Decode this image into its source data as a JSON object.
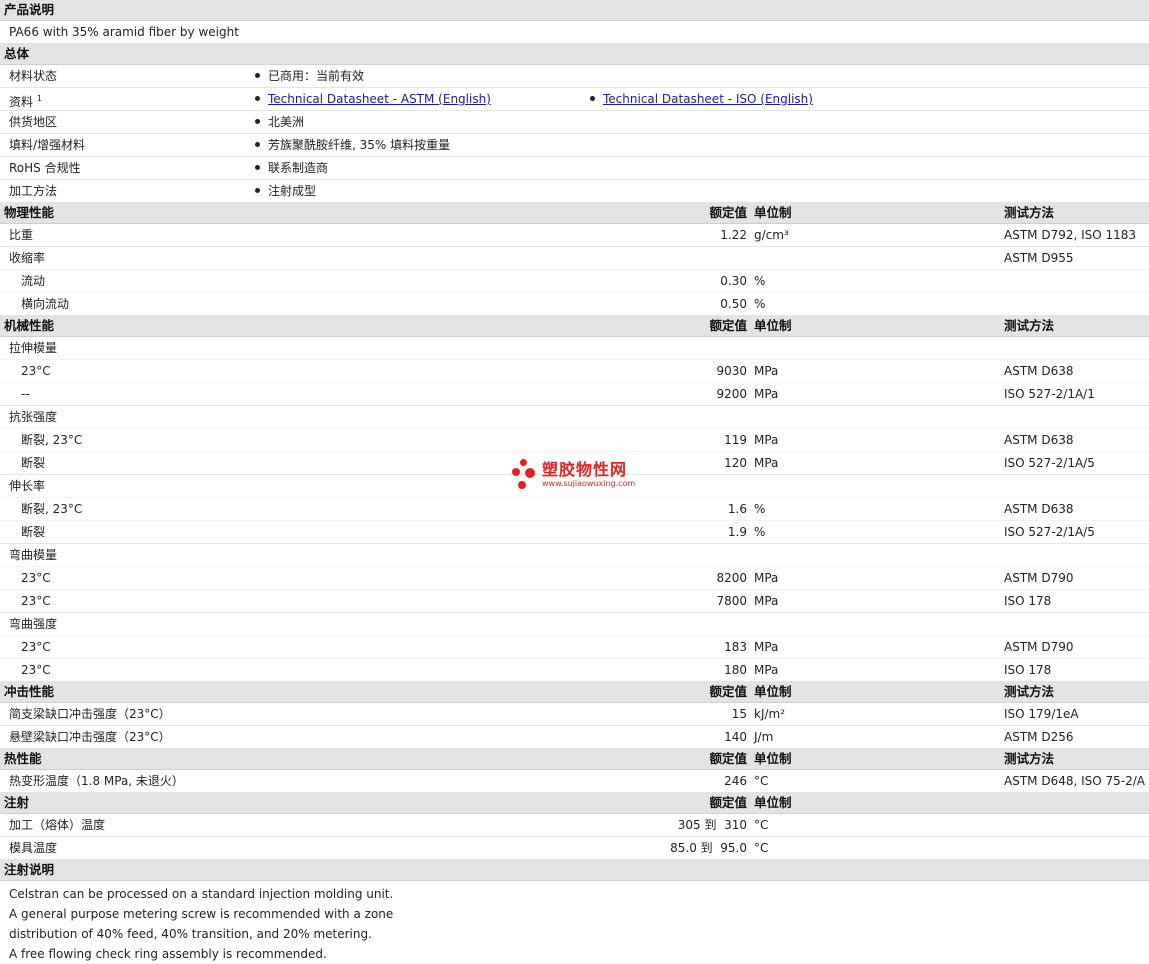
{
  "desc_section": {
    "title": "产品说明",
    "text": "PA66 with 35% aramid fiber by weight"
  },
  "general": {
    "title": "总体",
    "status_label": "材料状态",
    "status_value": "已商用：当前有效",
    "docs_label": "资料",
    "docs_sup": "1",
    "doc_astm": "Technical Datasheet - ASTM (English)",
    "doc_iso": "Technical Datasheet - ISO (English)",
    "region_label": "供货地区",
    "region_value": "北美洲",
    "filler_label": "填料/增强材料",
    "filler_value": "芳族聚酰胺纤维, 35% 填料按重量",
    "rohs_label": "RoHS 合规性",
    "rohs_value": "联系制造商",
    "process_label": "加工方法",
    "process_value": "注射成型"
  },
  "headers": {
    "value": "额定值",
    "unit": "单位制",
    "method": "测试方法"
  },
  "physical": {
    "title": "物理性能",
    "sg_label": "比重",
    "sg_value": "1.22",
    "sg_unit": "g/cm³",
    "sg_method": "ASTM D792, ISO 1183",
    "shrink_label": "收缩率",
    "shrink_method": "ASTM D955",
    "flow_label": "流动",
    "flow_value": "0.30",
    "flow_unit": "%",
    "tflow_label": "横向流动",
    "tflow_value": "0.50",
    "tflow_unit": "%"
  },
  "mechanical": {
    "title": "机械性能",
    "tm_label": "拉伸模量",
    "tm1_label": "23°C",
    "tm1_value": "9030",
    "tm1_unit": "MPa",
    "tm1_method": "ASTM D638",
    "tm2_label": "--",
    "tm2_value": "9200",
    "tm2_unit": "MPa",
    "tm2_method": "ISO 527-2/1A/1",
    "ts_label": "抗张强度",
    "ts1_label": "断裂, 23°C",
    "ts1_value": "119",
    "ts1_unit": "MPa",
    "ts1_method": "ASTM D638",
    "ts2_label": "断裂",
    "ts2_value": "120",
    "ts2_unit": "MPa",
    "ts2_method": "ISO 527-2/1A/5",
    "el_label": "伸长率",
    "el1_label": "断裂, 23°C",
    "el1_value": "1.6",
    "el1_unit": "%",
    "el1_method": "ASTM D638",
    "el2_label": "断裂",
    "el2_value": "1.9",
    "el2_unit": "%",
    "el2_method": "ISO 527-2/1A/5",
    "fm_label": "弯曲模量",
    "fm1_label": "23°C",
    "fm1_value": "8200",
    "fm1_unit": "MPa",
    "fm1_method": "ASTM D790",
    "fm2_label": "23°C",
    "fm2_value": "7800",
    "fm2_unit": "MPa",
    "fm2_method": "ISO 178",
    "fs_label": "弯曲强度",
    "fs1_label": "23°C",
    "fs1_value": "183",
    "fs1_unit": "MPa",
    "fs1_method": "ASTM D790",
    "fs2_label": "23°C",
    "fs2_value": "180",
    "fs2_unit": "MPa",
    "fs2_method": "ISO 178"
  },
  "impact": {
    "title": "冲击性能",
    "charpy_label": "简支梁缺口冲击强度（23°C）",
    "charpy_value": "15",
    "charpy_unit": "kJ/m²",
    "charpy_method": "ISO 179/1eA",
    "izod_label": "悬壁梁缺口冲击强度（23°C）",
    "izod_value": "140",
    "izod_unit": "J/m",
    "izod_method": "ASTM D256"
  },
  "thermal": {
    "title": "热性能",
    "hdt_label": "热变形温度（1.8 MPa, 未退火）",
    "hdt_value": "246",
    "hdt_unit": "°C",
    "hdt_method": "ASTM D648, ISO 75-2/A"
  },
  "injection": {
    "title": "注射",
    "melt_label": "加工（熔体）温度",
    "melt_value": "305 到  310",
    "melt_unit": "°C",
    "mold_label": "模具温度",
    "mold_value": "85.0 到  95.0",
    "mold_unit": "°C"
  },
  "notes": {
    "title": "注射说明",
    "lines": [
      "Celstran can be processed on a standard injection molding unit.",
      "A general purpose metering screw is recommended with a zone",
      "distribution of 40% feed, 40% transition, and 20% metering.",
      "A free flowing check ring assembly is recommended."
    ]
  },
  "watermark": {
    "cn": "塑胶物性网",
    "url": "www.sujiaowuxing.com",
    "color": "#e62020"
  }
}
